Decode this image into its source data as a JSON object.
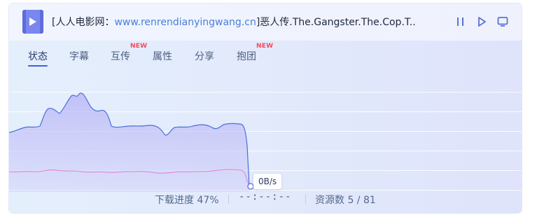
{
  "header": {
    "file_icon": "video-file-icon",
    "title_prefix": "[人人电影网：",
    "title_site": "www.renrendianyingwang.cn",
    "title_suffix": "]恶人传.The.Gangster.The.Cop.T...",
    "controls": [
      "pause-icon",
      "play-icon",
      "screen-icon"
    ]
  },
  "tabs": [
    {
      "label": "状态",
      "active": true,
      "badge": ""
    },
    {
      "label": "字幕",
      "active": false,
      "badge": ""
    },
    {
      "label": "互传",
      "active": false,
      "badge": "NEW"
    },
    {
      "label": "属性",
      "active": false,
      "badge": ""
    },
    {
      "label": "分享",
      "active": false,
      "badge": ""
    },
    {
      "label": "抱团",
      "active": false,
      "badge": "NEW"
    }
  ],
  "speed_chart": {
    "current_speed": "0B/s",
    "download_series_color": "#4a6fd8",
    "upload_series_color": "#e07fd0"
  },
  "footer": {
    "progress_label": "下载进度 47%",
    "eta": "--:--:--",
    "sources_label": "资源数 5 / 81"
  },
  "colors": {
    "accent": "#3a63d8",
    "badge": "#f24b5b",
    "site_link": "#4a7fd8"
  }
}
